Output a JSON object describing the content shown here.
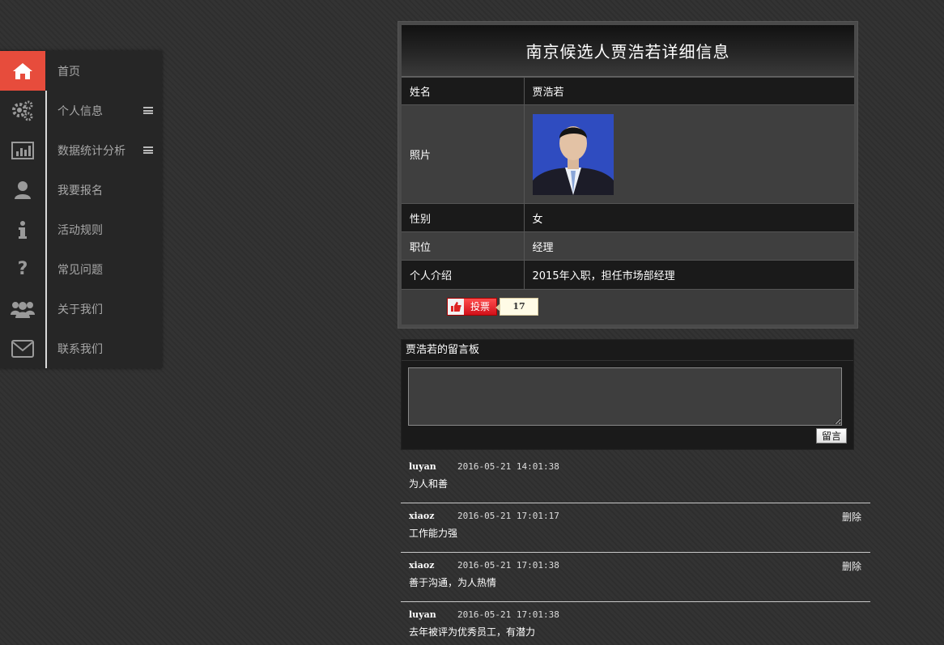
{
  "nav": {
    "items": [
      {
        "label": "首页",
        "icon": "home-icon",
        "active": true
      },
      {
        "label": "个人信息",
        "icon": "gears-icon",
        "submenu": true
      },
      {
        "label": "数据统计分析",
        "icon": "bar-chart-icon",
        "submenu": true
      },
      {
        "label": "我要报名",
        "icon": "user-icon"
      },
      {
        "label": "活动规则",
        "icon": "info-icon"
      },
      {
        "label": "常见问题",
        "icon": "question-icon"
      },
      {
        "label": "关于我们",
        "icon": "users-icon"
      },
      {
        "label": "联系我们",
        "icon": "envelope-icon"
      }
    ],
    "active_color": "#e74c3c"
  },
  "detail": {
    "title": "南京候选人贾浩若详细信息",
    "rows": [
      {
        "key": "姓名",
        "value": "贾浩若"
      },
      {
        "key": "照片",
        "value": ""
      },
      {
        "key": "性别",
        "value": "女"
      },
      {
        "key": "职位",
        "value": "经理"
      },
      {
        "key": "个人介绍",
        "value": "2015年入职，担任市场部经理"
      }
    ],
    "vote_label": "投票",
    "vote_count": "17"
  },
  "board": {
    "title": "贾浩若的留言板",
    "textarea_value": "",
    "submit_label": "留言"
  },
  "comments": [
    {
      "author": "luyan",
      "time": "2016-05-21 14:01:38",
      "text": "为人和善",
      "delete": ""
    },
    {
      "author": "xiaoz",
      "time": "2016-05-21 17:01:17",
      "text": "工作能力强",
      "delete": "删除"
    },
    {
      "author": "xiaoz",
      "time": "2016-05-21 17:01:38",
      "text": "善于沟通，为人热情",
      "delete": "删除"
    },
    {
      "author": "luyan",
      "time": "2016-05-21 17:01:38",
      "text": "去年被评为优秀员工，有潜力",
      "delete": ""
    }
  ]
}
